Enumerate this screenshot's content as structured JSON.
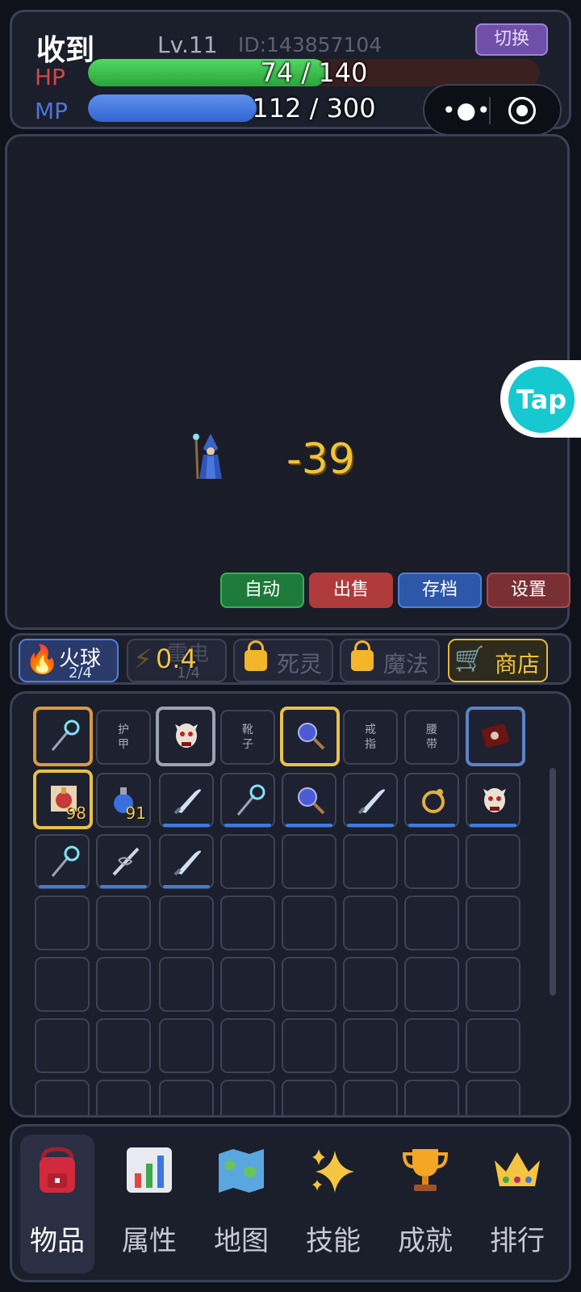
{
  "player": {
    "name": "收到",
    "level": "Lv.11",
    "id": "ID:143857104",
    "switch_label": "切换",
    "hp_label": "HP",
    "hp_text": "74 / 140",
    "hp_fraction": 0.529,
    "mp_label": "MP",
    "mp_text": "112 / 300",
    "mp_fraction": 0.373
  },
  "capsule": {
    "more_icon": "more-dots-icon",
    "close_icon": "target-icon"
  },
  "battle": {
    "damage": "-39",
    "tap_label": "Tap",
    "actions": {
      "auto": "自动",
      "sell": "出售",
      "save": "存档",
      "settings": "设置"
    }
  },
  "skills": {
    "fire": {
      "name": "火球",
      "count": "2/4",
      "icon": "flame-icon"
    },
    "thunder": {
      "name": "雷电",
      "count": "1/4",
      "cooldown": "0.4",
      "icon": "lightning-icon"
    },
    "death": {
      "name": "死灵",
      "icon": "lock-icon"
    },
    "magic": {
      "name": "魔法",
      "icon": "lock-icon"
    },
    "shop": {
      "name": "商店",
      "icon": "cart-icon"
    }
  },
  "inventory": {
    "equip_labels": {
      "armor": "护\n甲",
      "boots": "靴\n子",
      "ring": "戒\n指",
      "belt": "腰\n带"
    },
    "potion_red_qty": "98",
    "potion_blue_qty": "91"
  },
  "nav": {
    "items": {
      "label": "物品",
      "icon": "backpack-icon"
    },
    "stats": {
      "label": "属性",
      "icon": "bar-chart-icon"
    },
    "map": {
      "label": "地图",
      "icon": "map-icon"
    },
    "skills": {
      "label": "技能",
      "icon": "sparkle-icon"
    },
    "achievements": {
      "label": "成就",
      "icon": "trophy-icon"
    },
    "ranking": {
      "label": "排行",
      "icon": "crown-icon"
    }
  },
  "colors": {
    "hp": "#2aa43a",
    "mp": "#3265cf",
    "accent_gold": "#f0c436",
    "panel": "#1b1e2b"
  }
}
